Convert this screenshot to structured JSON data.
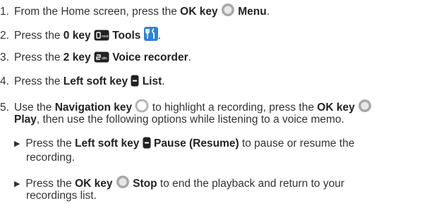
{
  "steps": [
    {
      "num": "1.",
      "pre": "From the Home screen, press the ",
      "key": "OK key",
      "post_bold": "Menu",
      "post": "."
    },
    {
      "num": "2.",
      "pre": "Press the ",
      "key": "0 key",
      "keycap": "next",
      "post_bold": "Tools",
      "post": "."
    },
    {
      "num": "3.",
      "pre": "Press the ",
      "key": "2 key",
      "keycap": "abc",
      "post_bold": "Voice recorder",
      "post": "."
    },
    {
      "num": "4.",
      "pre": "Press the ",
      "key": "Left soft key",
      "post_bold": "List",
      "post": "."
    },
    {
      "num": "5.",
      "pre": "Use the ",
      "nav_key": "Navigation key",
      "mid": "to highlight a recording, press the ",
      "key": "OK key",
      "line2_bold": "Play",
      "line2": ", then use the following options while listening to a voice memo."
    }
  ],
  "options": [
    {
      "pre": "Press the ",
      "key": "Left soft key",
      "post_bold": "Pause (Resume)",
      "post": " to pause or resume the",
      "cont": "recording."
    },
    {
      "pre": "Press the ",
      "key": "OK key",
      "post_bold": "Stop",
      "post": " to end the playback and return to your",
      "cont": "recordings list."
    }
  ]
}
